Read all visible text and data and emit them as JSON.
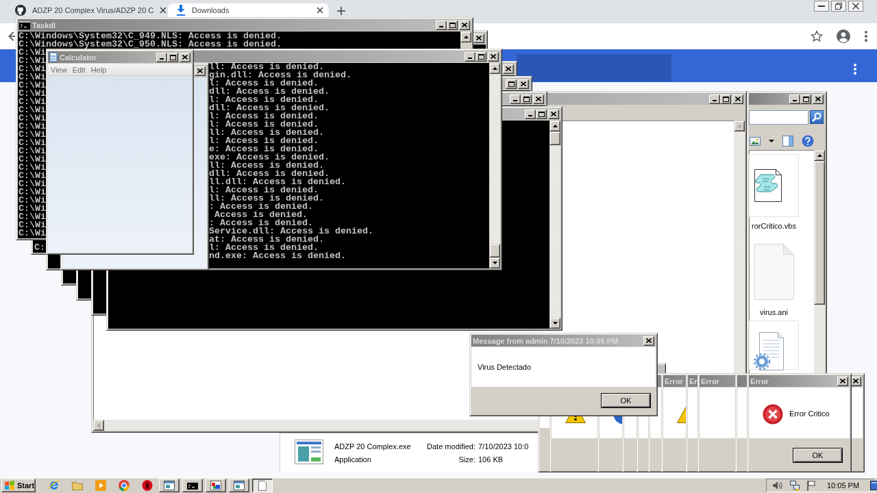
{
  "browser": {
    "tabs": [
      {
        "title": "ADZP 20 Complex Virus/ADZP 20 C",
        "selected": false
      },
      {
        "title": "Downloads",
        "selected": true
      }
    ]
  },
  "windows": [
    {
      "kind": "explorer",
      "files": [
        {
          "name": "rorCritico.vbs",
          "kind": "script"
        },
        {
          "name": "virus.ani",
          "kind": "blank"
        },
        {
          "kind": "settings"
        }
      ]
    },
    {
      "kind": "details",
      "name": "ADZP 20 Complex.exe",
      "file_type": "Application",
      "fields": [
        {
          "label": "Date modified:",
          "value": "7/10/2023 10:0"
        },
        {
          "label": "Size:",
          "value": "106 KB"
        }
      ]
    },
    {
      "kind": "explorer"
    },
    {
      "kind": "console",
      "title": "Taskdl",
      "lines": [
        "C:\\Windows\\System32\\C_949.NLS: Access is denied.",
        "C:\\Windows\\System32\\C_950.NLS: Access is denied.",
        "C:\\Wi",
        "C:\\Wi",
        "C:\\Wi",
        "C:\\Wi",
        "C:\\Wi",
        "C:\\Wi",
        "C:\\Wi",
        "C:\\Wi",
        "C:\\Wi",
        "C:\\Wi",
        "C:\\Wi",
        "C:\\Wi",
        "C:\\Wi",
        "C:\\Wi",
        "C:\\Wi",
        "C:\\Wi",
        "C:\\Wi",
        "C:\\Wi",
        "C:\\Wi",
        "C:\\Wi",
        "C:\\Wi",
        "C:\\Wi",
        "C:\\Wi"
      ]
    },
    {
      "kind": "console",
      "lines": [
        "C:"
      ]
    },
    {
      "kind": "console"
    },
    {
      "kind": "console"
    },
    {
      "kind": "console"
    },
    {
      "kind": "console"
    },
    {
      "kind": "console",
      "lines": [
        "ll: Access is denied.",
        "gin.dll: Access is denied.",
        "l: Access is denied.",
        "dll: Access is denied.",
        "l: Access is denied.",
        "dll: Access is denied.",
        "l: Access is denied.",
        "l: Access is denied.",
        "ll: Access is denied.",
        "l: Access is denied.",
        "e: Access is denied.",
        "exe: Access is denied.",
        "ll: Access is denied.",
        "dll: Access is denied.",
        "ll.dll: Access is denied.",
        "l: Access is denied.",
        "ll: Access is denied.",
        ": Access is denied.",
        " Access is denied.",
        ": Access is denied.",
        "Service.dll: Access is denied.",
        "at: Access is denied.",
        "l: Access is denied.",
        "nd.exe: Access is denied."
      ]
    },
    {
      "kind": "calculator"
    },
    {
      "kind": "calculator",
      "title": "Calculator",
      "menu": [
        "View",
        "Edit",
        "Help"
      ]
    },
    {
      "kind": "dialog"
    },
    {
      "kind": "dialog",
      "icon": {
        "kind": "warning"
      }
    },
    {
      "kind": "dialog",
      "icon": {
        "kind": "info"
      }
    },
    {
      "kind": "dialog"
    },
    {
      "kind": "dialog"
    },
    {
      "kind": "dialog"
    },
    {
      "kind": "dialog",
      "title": "Error",
      "icon": {
        "kind": "warning"
      }
    },
    {
      "kind": "dialog",
      "title": "Er"
    },
    {
      "kind": "dialog",
      "title": "Error"
    },
    {
      "kind": "dialog"
    },
    {
      "kind": "dialog"
    },
    {
      "kind": "dialog",
      "title": "Error",
      "icon": {
        "kind": "error"
      },
      "message": "Error Critico",
      "button": "OK"
    },
    {
      "kind": "message",
      "title": "Message from admin 7/10/2023 10:05 PM",
      "message": "Virus Detectado",
      "button": "OK"
    }
  ],
  "taskbar": {
    "start": "Start",
    "tasks": [
      {
        "selected": false
      },
      {
        "selected": false
      },
      {
        "selected": false
      },
      {
        "selected": false
      },
      {
        "selected": true
      }
    ],
    "clock": "10:05 PM"
  }
}
